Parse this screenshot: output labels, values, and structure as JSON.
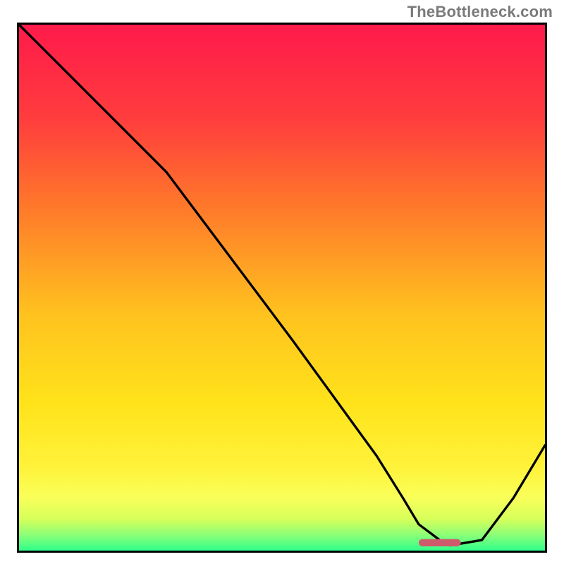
{
  "watermark": "TheBottleneck.com",
  "chart_data": {
    "type": "line",
    "title": "",
    "xlabel": "",
    "ylabel": "",
    "xlim": [
      0,
      100
    ],
    "ylim": [
      0,
      100
    ],
    "grid": false,
    "legend": false,
    "gradient_stops": [
      {
        "offset": 0.0,
        "color": "#ff1a4b"
      },
      {
        "offset": 0.18,
        "color": "#ff3d3d"
      },
      {
        "offset": 0.35,
        "color": "#ff7a2a"
      },
      {
        "offset": 0.55,
        "color": "#ffc21f"
      },
      {
        "offset": 0.72,
        "color": "#ffe31a"
      },
      {
        "offset": 0.84,
        "color": "#fff23a"
      },
      {
        "offset": 0.9,
        "color": "#f9ff5a"
      },
      {
        "offset": 0.94,
        "color": "#d6ff5a"
      },
      {
        "offset": 0.97,
        "color": "#8cff78"
      },
      {
        "offset": 1.0,
        "color": "#2fff8a"
      }
    ],
    "series": [
      {
        "name": "bottleneck-curve",
        "x": [
          0,
          10,
          20,
          28,
          40,
          52,
          60,
          68,
          73,
          76,
          80,
          82,
          88,
          94,
          100
        ],
        "y": [
          100,
          90,
          80,
          72,
          56,
          40,
          29,
          18,
          10,
          5,
          2,
          1,
          2,
          10,
          20
        ]
      }
    ],
    "marker": {
      "name": "optimal-range-marker",
      "x_center": 80,
      "y": 1.5,
      "width": 8,
      "color": "#cf5a6b"
    }
  }
}
